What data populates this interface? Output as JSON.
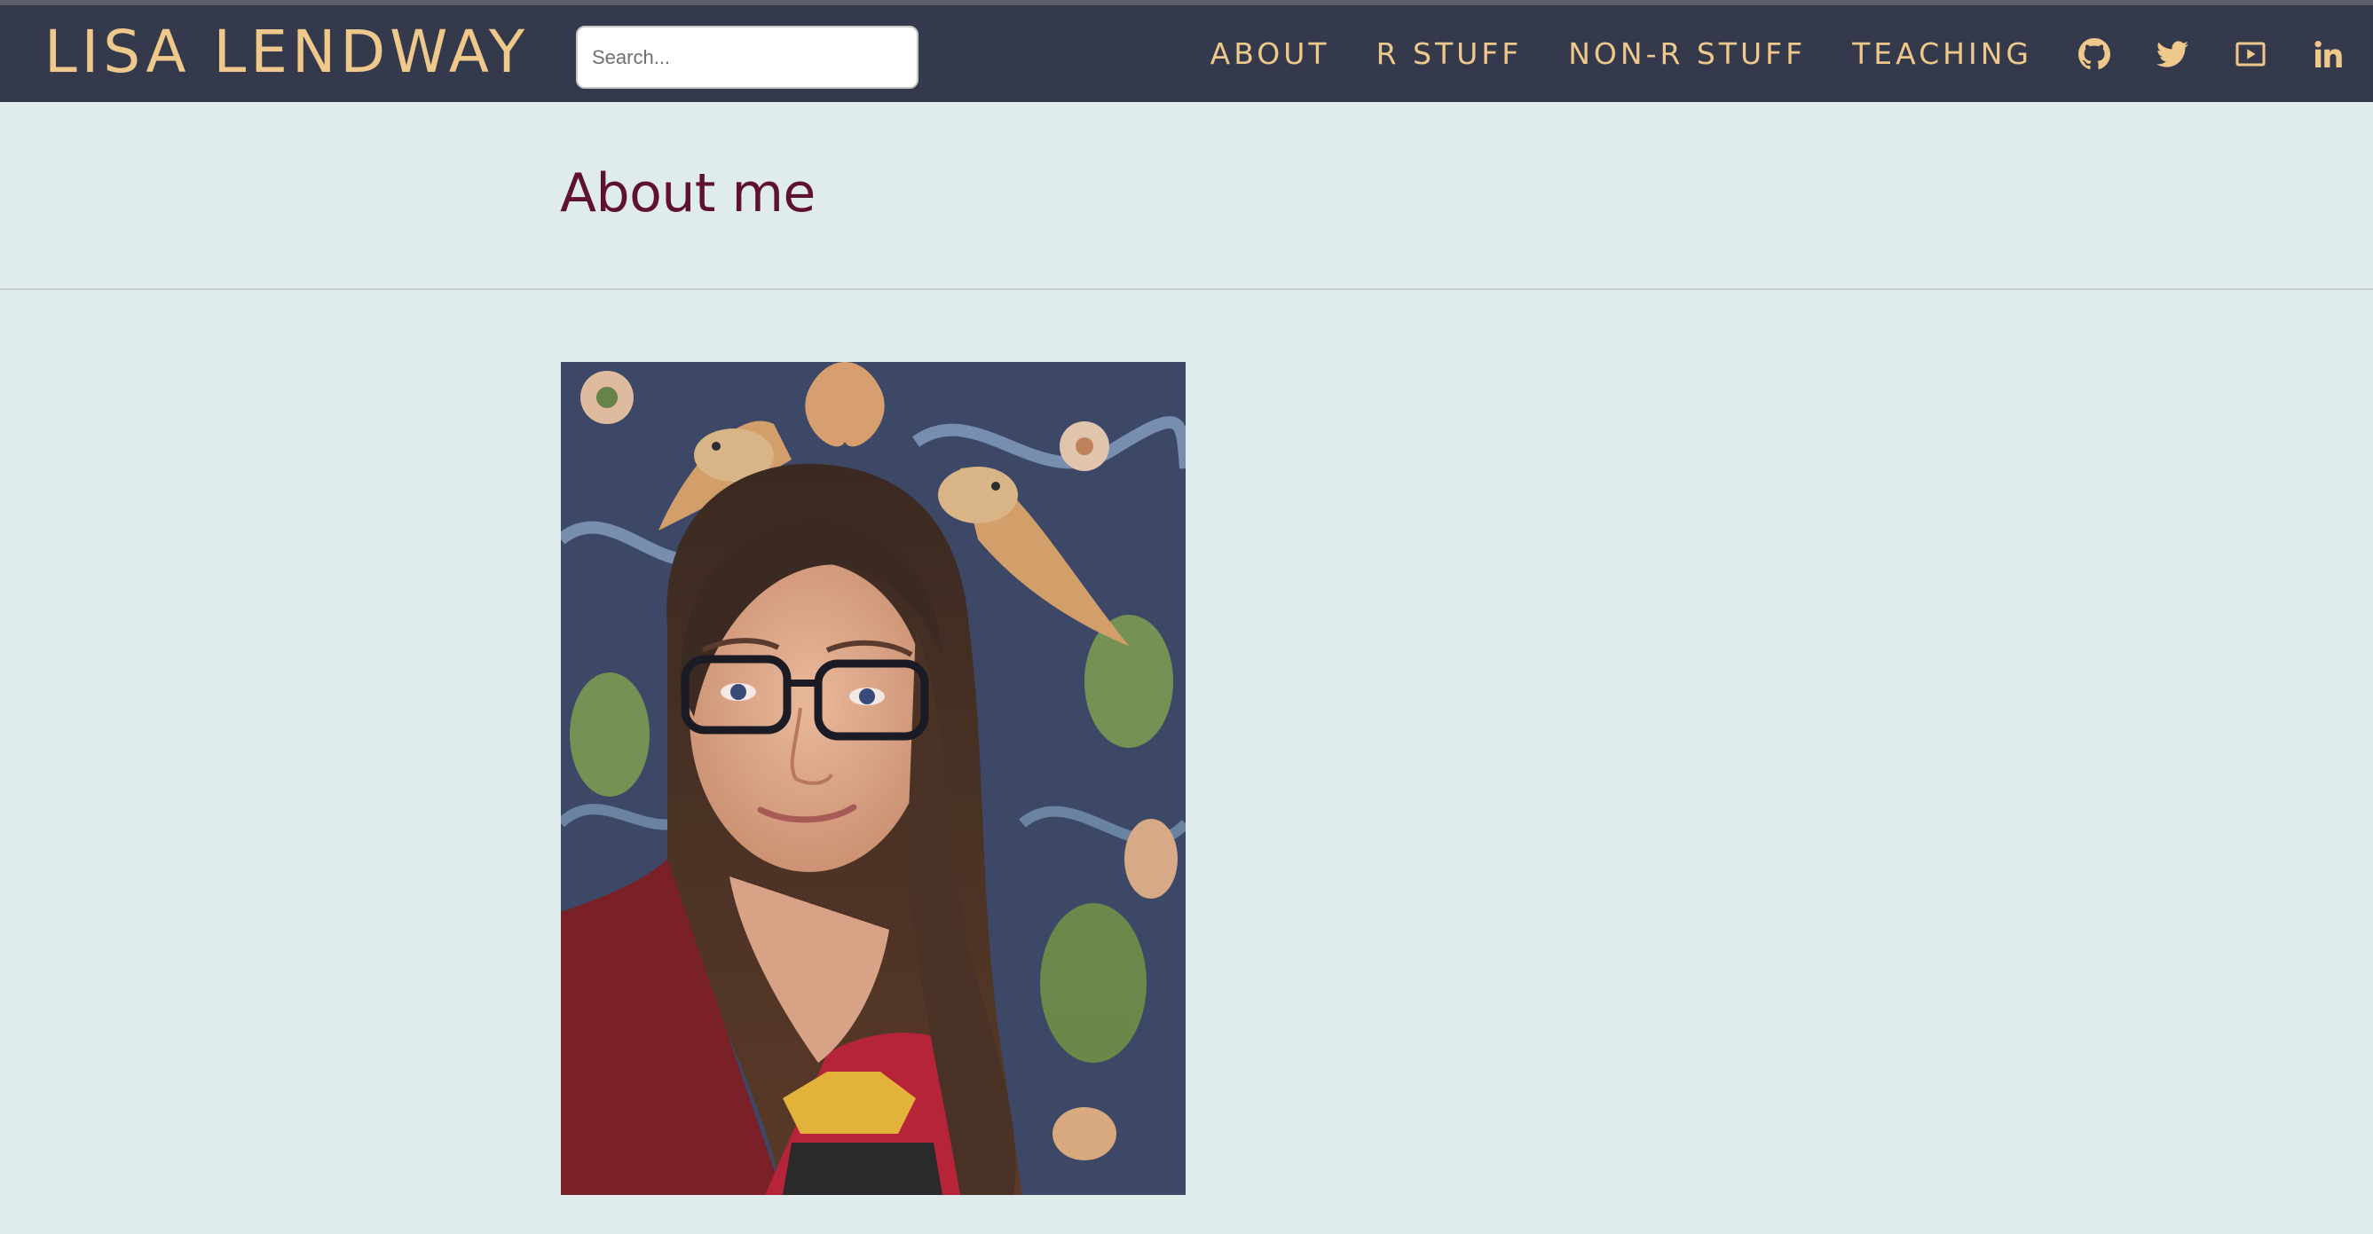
{
  "site": {
    "title": "LISA LENDWAY"
  },
  "search": {
    "placeholder": "Search...",
    "value": ""
  },
  "nav": {
    "about": "ABOUT",
    "r_stuff": "R STUFF",
    "non_r_stuff": "NON-R STUFF",
    "teaching": "TEACHING",
    "icons": [
      "github-icon",
      "twitter-icon",
      "youtube-icon",
      "linkedin-icon"
    ]
  },
  "page": {
    "title": "About me"
  },
  "colors": {
    "topbar_bg": "#343a4b",
    "accent_gold": "#efc88b",
    "page_bg": "#e0ebec",
    "title_color": "#5e1230"
  }
}
